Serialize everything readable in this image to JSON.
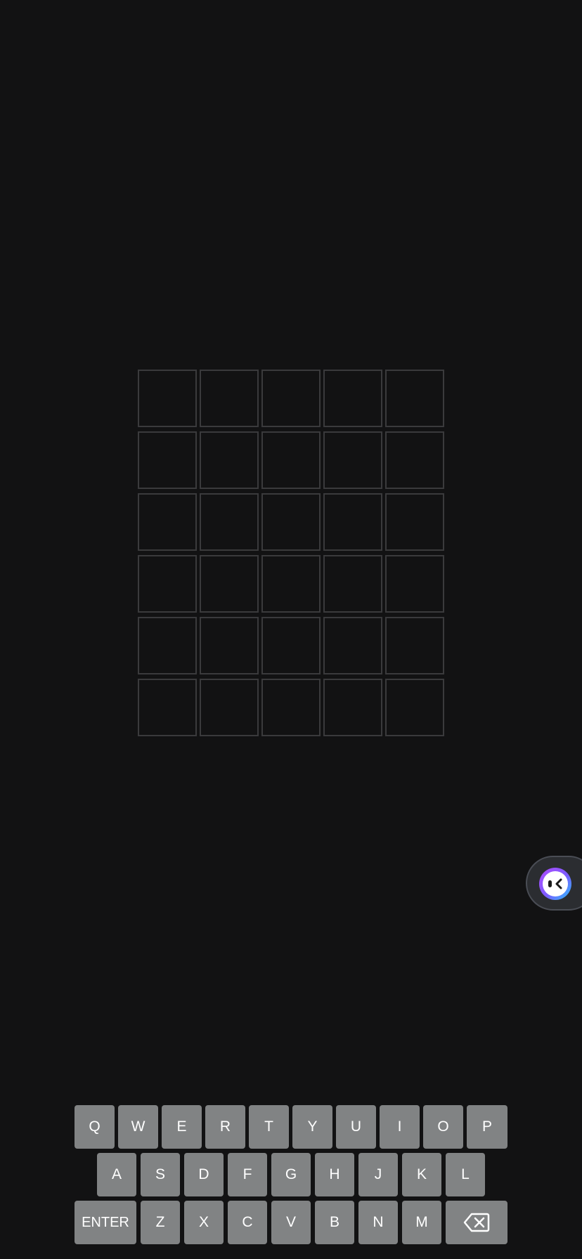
{
  "board": {
    "rows": [
      [
        "",
        "",
        "",
        "",
        ""
      ],
      [
        "",
        "",
        "",
        "",
        ""
      ],
      [
        "",
        "",
        "",
        "",
        ""
      ],
      [
        "",
        "",
        "",
        "",
        ""
      ],
      [
        "",
        "",
        "",
        "",
        ""
      ],
      [
        "",
        "",
        "",
        "",
        ""
      ]
    ]
  },
  "keyboard": {
    "row1": [
      "Q",
      "W",
      "E",
      "R",
      "T",
      "Y",
      "U",
      "I",
      "O",
      "P"
    ],
    "row2": [
      "A",
      "S",
      "D",
      "F",
      "G",
      "H",
      "J",
      "K",
      "L"
    ],
    "row3": [
      "Z",
      "X",
      "C",
      "V",
      "B",
      "N",
      "M"
    ],
    "enter_label": "ENTER",
    "backspace_icon": "backspace-icon",
    "key_color": "#818384"
  },
  "assistant": {
    "icon": "assistant-face-icon"
  },
  "colors": {
    "background": "#121213",
    "tile_border": "#3a3a3c"
  }
}
